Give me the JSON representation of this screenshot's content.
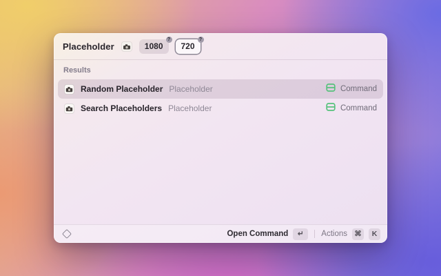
{
  "window": {
    "header": {
      "query": "Placeholder",
      "tokens": [
        {
          "value": "1080",
          "badge": "?",
          "focused": false
        },
        {
          "value": "720",
          "badge": "?",
          "focused": true
        }
      ]
    },
    "results": {
      "section_label": "Results",
      "items": [
        {
          "title": "Random Placeholder",
          "subtitle": "Placeholder",
          "accessory": "Command",
          "selected": true
        },
        {
          "title": "Search Placeholders",
          "subtitle": "Placeholder",
          "accessory": "Command",
          "selected": false
        }
      ]
    },
    "footer": {
      "primary_action": "Open Command",
      "primary_key": "↵",
      "secondary_action": "Actions",
      "secondary_keys": [
        "⌘",
        "K"
      ]
    },
    "icons": {
      "app_icon": "camera-placeholder-icon",
      "row_icon": "camera-placeholder-icon",
      "accessory_icon": "command-window-icon",
      "footer_icon": "diamond-logo-icon"
    },
    "colors": {
      "accessory_green": "#55c17b",
      "selection_tint": "#d9cdda",
      "window_tint": "#f2e5f2"
    }
  }
}
